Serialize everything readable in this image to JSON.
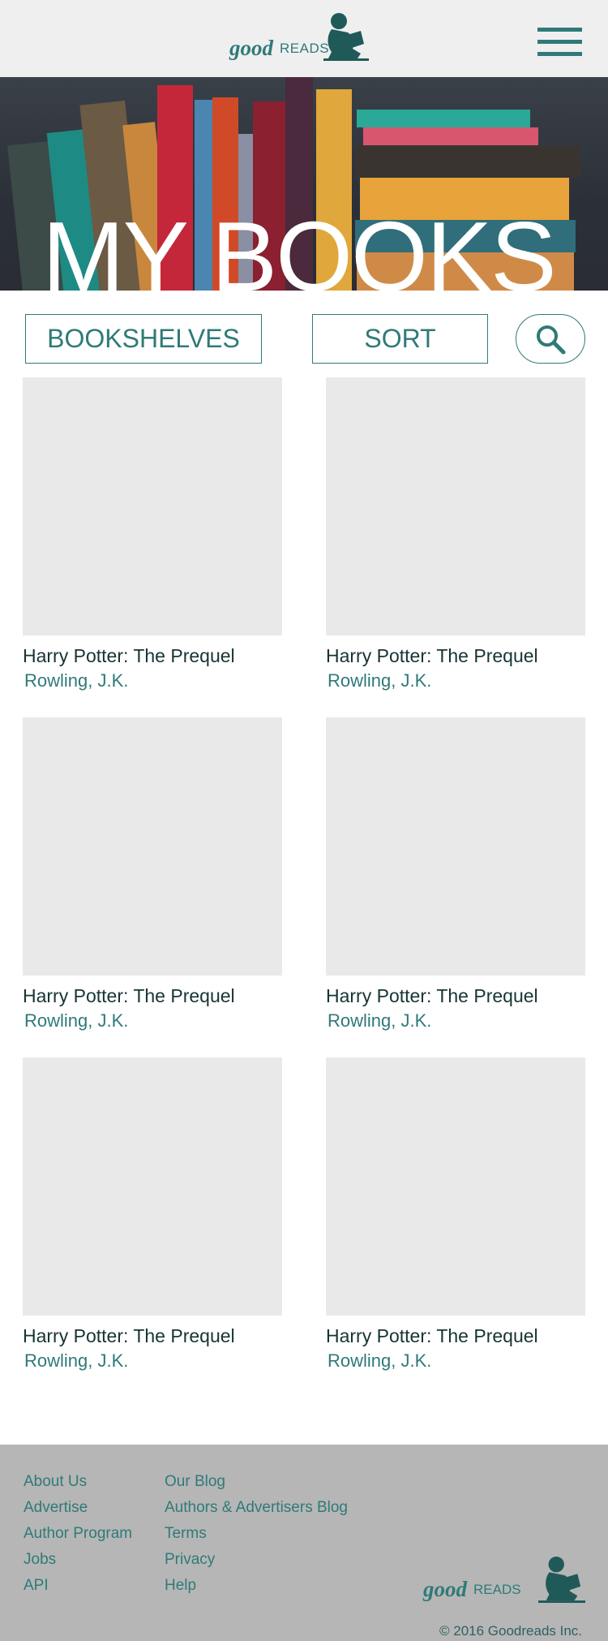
{
  "header": {
    "logo_good": "good",
    "logo_reads": "READS",
    "menu_icon": "hamburger-menu-icon"
  },
  "hero": {
    "title": "MY BOOKS"
  },
  "controls": {
    "bookshelves_label": "BOOKSHELVES",
    "sort_label": "SORT",
    "search_icon": "search-icon"
  },
  "books": [
    {
      "title": "Harry Potter: The Prequel",
      "author": "Rowling, J.K."
    },
    {
      "title": "Harry Potter: The Prequel",
      "author": "Rowling, J.K."
    },
    {
      "title": "Harry Potter: The Prequel",
      "author": "Rowling, J.K."
    },
    {
      "title": "Harry Potter: The Prequel",
      "author": "Rowling, J.K."
    },
    {
      "title": "Harry Potter: The Prequel",
      "author": "Rowling, J.K."
    },
    {
      "title": "Harry Potter: The Prequel",
      "author": "Rowling, J.K."
    }
  ],
  "footer": {
    "col1": [
      "About Us",
      "Advertise",
      "Author Program",
      "Jobs",
      "API"
    ],
    "col2": [
      "Our Blog",
      "Authors & Advertisers Blog",
      "Terms",
      "Privacy",
      "Help"
    ],
    "logo_good": "good",
    "logo_reads": "READS",
    "copyright": "© 2016 Goodreads Inc."
  },
  "colors": {
    "accent": "#2f7a78",
    "header_bg": "#efefef",
    "footer_bg": "#b6b6b6",
    "cover_placeholder": "#e9e9e9"
  }
}
